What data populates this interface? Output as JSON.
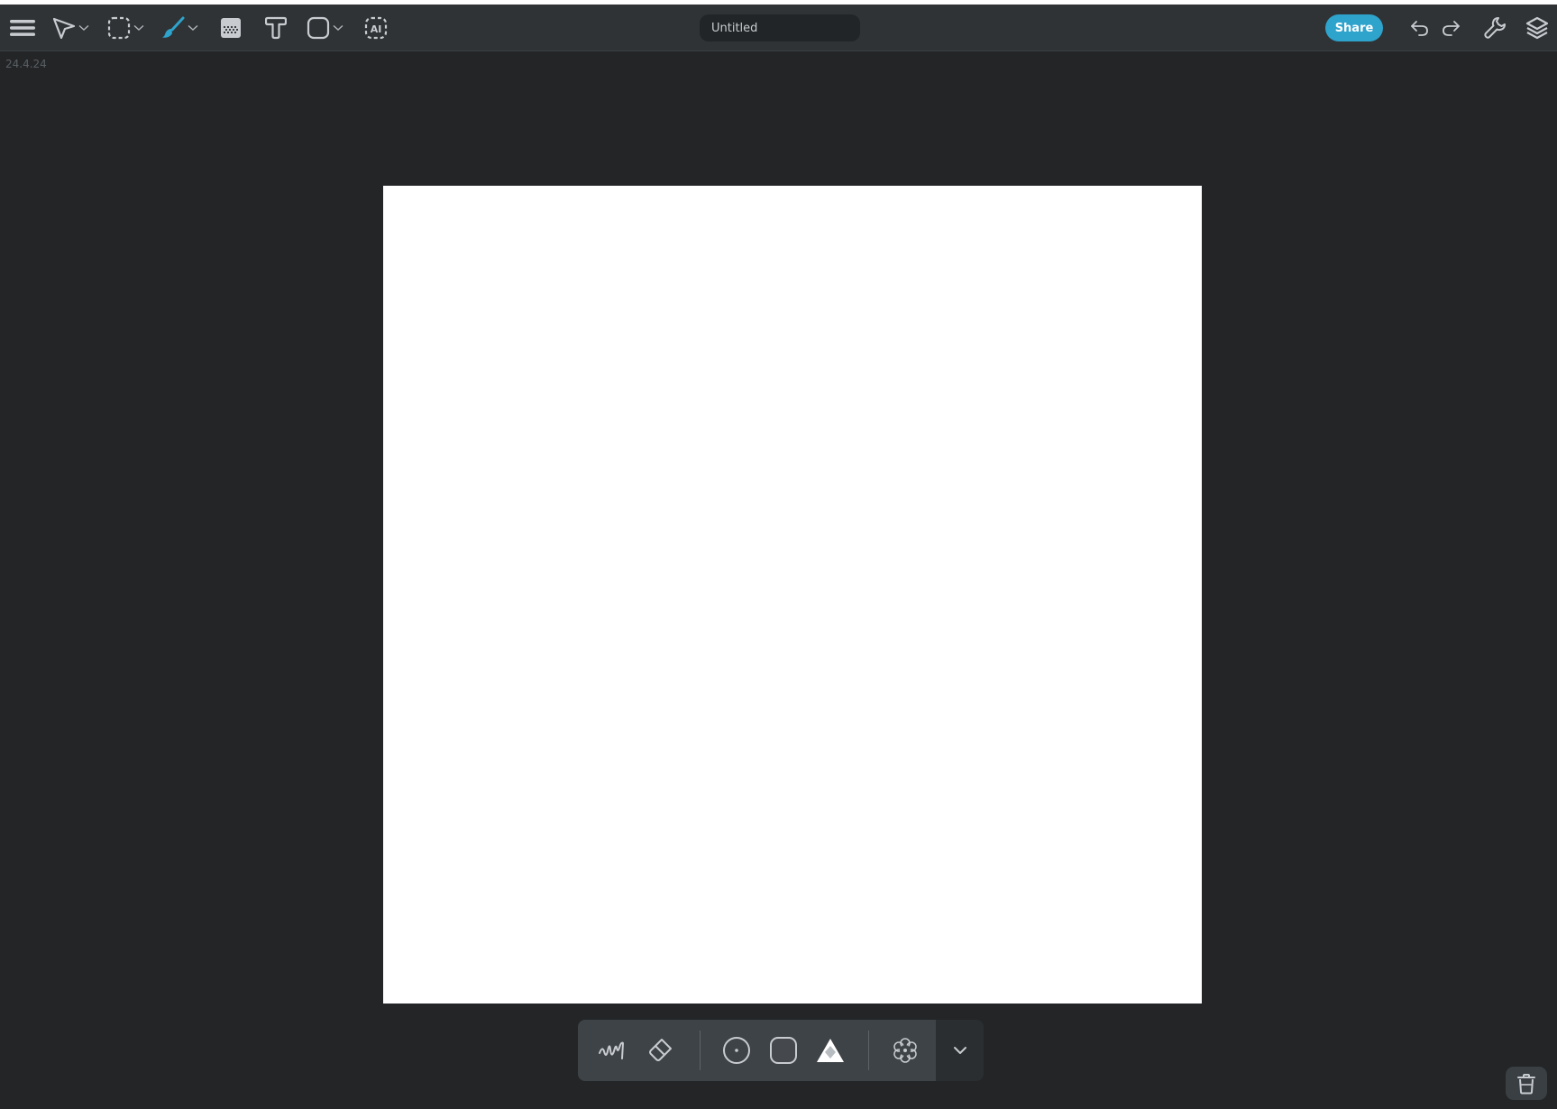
{
  "app": {
    "version": "24.4.24"
  },
  "toolbar": {
    "tools": [
      {
        "name": "menu",
        "icon": "hamburger-menu-icon"
      },
      {
        "name": "select",
        "icon": "pointer-arrow-icon",
        "has_dropdown": true
      },
      {
        "name": "marquee-select",
        "icon": "dashed-square-icon",
        "has_dropdown": true
      },
      {
        "name": "brush",
        "icon": "paintbrush-icon",
        "has_dropdown": true,
        "active": true
      },
      {
        "name": "fill",
        "icon": "fill-pattern-icon"
      },
      {
        "name": "text",
        "icon": "text-t-icon"
      },
      {
        "name": "shape",
        "icon": "rounded-square-icon",
        "has_dropdown": true
      },
      {
        "name": "ai",
        "icon": "ai-dashed-icon"
      }
    ],
    "title_value": "Untitled",
    "share_label": "Share",
    "right_icons": [
      "undo-icon",
      "redo-icon",
      "wrench-icon",
      "layers-icon"
    ]
  },
  "colors": {
    "accent": "#2ea3cc",
    "toolbar_bg": "#2f3336",
    "workspace_bg": "#232527",
    "canvas_bg": "#ffffff",
    "icon": "#c8ccd0"
  },
  "bottom_toolbar": {
    "tools": [
      {
        "name": "brush-stroke",
        "icon": "squiggle-icon"
      },
      {
        "name": "eraser",
        "icon": "eraser-icon"
      },
      {
        "name": "brush-size",
        "icon": "circle-dot-icon"
      },
      {
        "name": "texture",
        "icon": "textured-square-icon"
      },
      {
        "name": "opacity",
        "icon": "triangle-opacity-icon"
      },
      {
        "name": "brush-settings",
        "icon": "flower-gear-icon"
      }
    ],
    "expand_icon": "chevron-down-icon"
  },
  "trash": {
    "icon": "trash-icon"
  }
}
